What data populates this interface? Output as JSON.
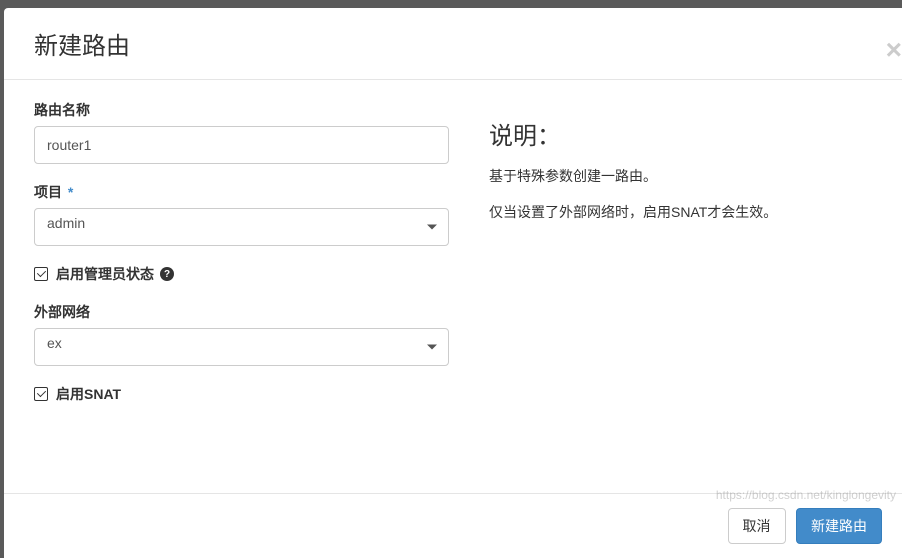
{
  "header": {
    "title": "新建路由"
  },
  "form": {
    "router_name": {
      "label": "路由名称",
      "value": "router1"
    },
    "project": {
      "label": "项目",
      "value": "admin"
    },
    "admin_state": {
      "label": "启用管理员状态"
    },
    "external_network": {
      "label": "外部网络",
      "value": "ex"
    },
    "enable_snat": {
      "label": "启用SNAT"
    }
  },
  "description": {
    "title": "说明：",
    "line1": "基于特殊参数创建一路由。",
    "line2": "仅当设置了外部网络时，启用SNAT才会生效。"
  },
  "footer": {
    "cancel": "取消",
    "submit": "新建路由"
  },
  "watermark": "https://blog.csdn.net/kinglongevity"
}
